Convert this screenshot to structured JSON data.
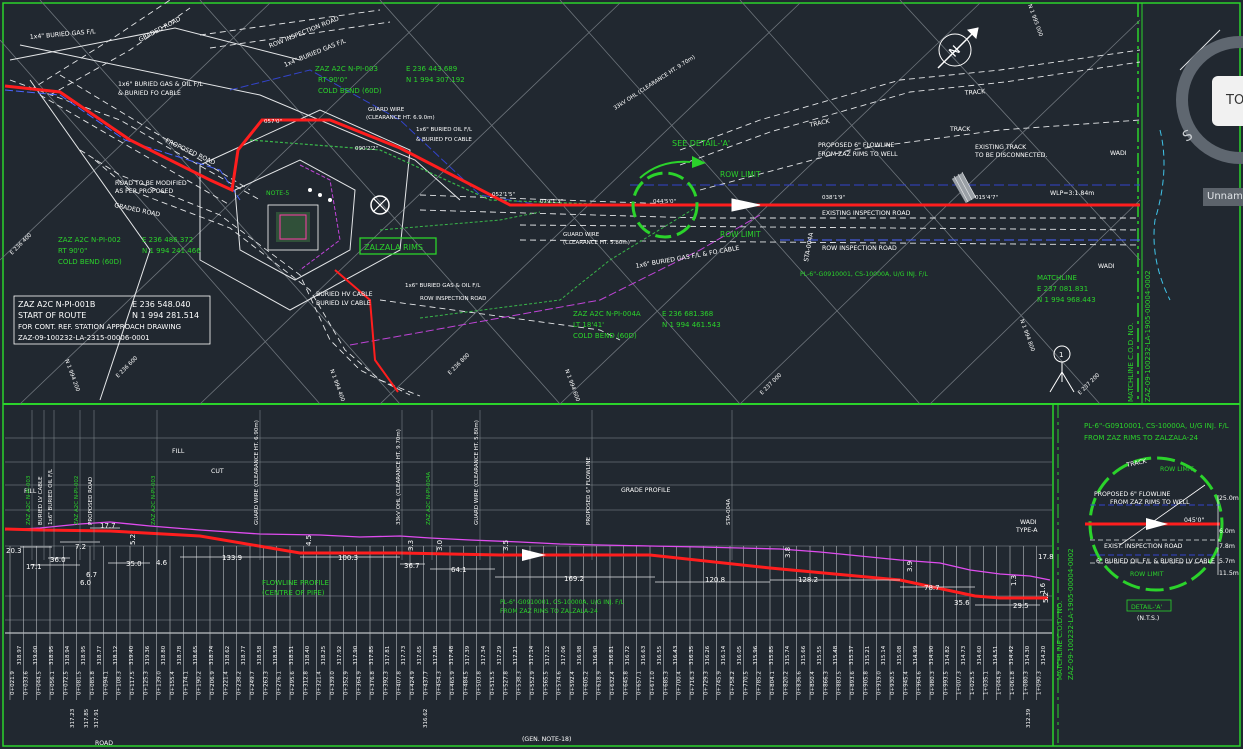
{
  "drawing": {
    "north_label": "N",
    "south_label": "S",
    "viewcube_top": "TOP",
    "unnamed_label": "Unnamed",
    "plan_labels": {
      "buried_gas_1": "1x4\" BURIED GAS F/L",
      "graded_road_1": "GRADED ROAD",
      "row_inspection_road": "ROW INSPECTION ROAD",
      "buried_gas_2": "1x4\" BURIED GAS F/L",
      "pi003_title": "ZAZ A2C N-PI-003",
      "pi003_e": "E   236 443.689",
      "pi003_rt": "RT 90'0\"",
      "pi003_n": "N 1 994 307.192",
      "pi003_bend": "COLD BEND (60D)",
      "ohl_33kv": "33kV OHL (CLEARANCE HT. 9.70m)",
      "buried_gas_oil": "1x6\" BURIED GAS & OIL F/L",
      "buried_fo": "& BURIED FO CABLE",
      "guard_wire_1": "GUARD WIRE",
      "guard_wire_1b": "(CLEARANCE HT. 6.9.0m)",
      "buried_oil_fl": "1x6\" BURIED OIL F/L",
      "buried_fo2": "& BURIED FO CABLE",
      "angle_057": "057'0\"",
      "angle_090": "090'2'2\"",
      "angle_052": "052'1'5\"",
      "angle_079": "079'1'3\"",
      "angle_044": "044'5'0\"",
      "angle_038": "038'1'9\"",
      "angle_015": "015'4'7\"",
      "proposed_road": "PROPOSED ROAD",
      "road_modified_1": "ROAD TO BE MODIFIED",
      "road_modified_2": "AS PER PROPOSED",
      "graded_road_2": "GRADED ROAD",
      "note5": "NOTE-5",
      "see_detail": "SEE DETAIL-'A'",
      "row_limit_1": "ROW LIMIT",
      "row_limit_2": "ROW LIMIT",
      "proposed_flowline_1": "PROPOSED 6\" FLOWLINE",
      "proposed_flowline_2": "FROM ZAZ RIMS TO WELL",
      "track_1": "TRACK",
      "track_2": "TRACK",
      "track_3": "TRACK",
      "existing_track_1": "EXISTING TRACK",
      "existing_track_2": "TO BE DISCONNECTED.",
      "wadi_1": "WADI",
      "wadi_2": "WADI",
      "wlp": "WLP=3:1.84m",
      "existing_inspection_road": "EXISTING INSPECTION ROAD",
      "row_inspection_road_2": "ROW INSPECTION ROAD",
      "sta004a": "STA-004A",
      "pl_green": "PL-6\"-G0910001, CS-10000A, U/G INJ. F/L",
      "guard_wire_2": "GUARD WIRE",
      "guard_wire_2b": "(CLEARANCE HT. 5.80m)",
      "buried_gas_fo": "1x6\" BURIED GAS F/L & FO CABLE",
      "matchline": "MATCHLINE",
      "matchline_e": "E   237 081.831",
      "matchline_n": "N 1 994 968.443",
      "zalzala_rims": "ZALZALA RIMS",
      "pi002_title": "ZAZ A2C N-PI-002",
      "pi002_e": "E   236 486.372",
      "pi002_rt": "RT 90'0\"",
      "pi002_n": "N 1 994 241.466",
      "pi002_bend": "COLD BEND (60D)",
      "buried_hv": "BURIED HV CABLE",
      "buried_lv": "BURIED LV CABLE",
      "buried_gas_oil_2": "1x6\" BURIED GAS & OIL F/L",
      "row_inspection_road_3": "ROW INSPECTION ROAD",
      "pi004a_title": "ZAZ A2C N-PI-004A",
      "pi004a_e": "E   236 681.368",
      "pi004a_lt": "LT 18'41'",
      "pi004a_n": "N 1 994 461.543",
      "pi004a_bend": "COLD BEND (60D)",
      "pi001b_title": "ZAZ A2C N-PI-001B",
      "pi001b_e": "E   236 548.040",
      "pi001b_start": "START OF ROUTE",
      "pi001b_n": "N 1 994 281.514",
      "pi001b_cont": "FOR CONT. REF. STATION APPROACH DRAWING",
      "pi001b_dwg": "ZAZ-09-100232-LA-2315-00006-0001",
      "grid_e236400": "E 236 400",
      "grid_e236600": "E 236 600",
      "grid_e236800": "E 236 800",
      "grid_n1994200": "N 1 994 200",
      "grid_n1994400": "N 1 994 400",
      "grid_e237000": "E 237 000",
      "grid_e237200": "E 237 200",
      "grid_n1994800": "N 1 994 800",
      "grid_n1995000": "N 1 995 000",
      "grid_n1994600": "N 1 994 600",
      "matchline_dwg_1": "MATCHLINE C.O.D. NO.",
      "matchline_dwg_2": "ZAZ-09-100232-LA-1905-00004-0002",
      "circle_1": "1"
    },
    "profile_labels": {
      "fill_1": "FILL",
      "cut": "CUT",
      "fill_2": "FILL",
      "grade_profile": "GRADE PROFILE",
      "flowline_profile_1": "FLOWLINE PROFILE",
      "flowline_profile_2": "(CENTRE OF PIPE)",
      "pl_green_1": "PL-6\"-G0910001, CS-10000A, U/G INJ. F/L",
      "pl_green_2": "FROM ZAZ RIMS TO ZALZALA-24",
      "gen_note": "(GEN. NOTE-18)",
      "road_bottom": "ROAD",
      "wadi_type": "WADI",
      "wadi_type_2": "TYPE-A",
      "vertical_labels": [
        "ZAZ A2C N-PI-003",
        "BURIED LV CABLE",
        "1x6\" BURIED OIL F/L",
        "ZAZ A2C N-PI-002",
        "PROPOSED ROAD",
        "ZAZ A2C N-PI-003",
        "GUARD WIRE (CLEARANCE HT. 6.90m)",
        "33kV OHL (CLEARANCE HT. 9.70m)",
        "ZAZ A2C N-PI-004A",
        "GUARD WIRE (CLEARANCE HT. 5.80m)",
        "PROPOSED 6\" FLOWLINE",
        "STA-004A"
      ],
      "dimensions_top": [
        "20.3",
        "17.1",
        "36.0",
        "7.2",
        "17.7",
        "5.2",
        "4.6",
        "35.0",
        "6.0",
        "6.7",
        "133.9",
        "100.3",
        "4.5",
        "36.7",
        "3.3",
        "3.0",
        "64.1",
        "3.5",
        "169.2",
        "120.8",
        "3.8",
        "128.2",
        "3.9",
        "78.7",
        "35.6",
        "29.5",
        "1.3",
        "17.8",
        "1.6",
        "5.2"
      ],
      "detail_title_1": "PL-6\"-G0910001, CS-10000A, U/G INJ. F/L",
      "detail_title_2": "FROM ZAZ RIMS TO ZALZALA-24",
      "detail_track": "TRACK",
      "detail_row_limit_1": "ROW LIMIT",
      "detail_row_limit_2": "ROW LIMIT",
      "detail_flowline_1": "PROPOSED 6\" FLOWLINE",
      "detail_flowline_2": "FROM ZAZ RIMS TO WELL",
      "detail_exist_road": "EXIST. INSPECTION ROAD",
      "detail_buried": "6\" BURIED OIL F/L & BURIED LV CABLE",
      "detail_angle": "045'0\"",
      "detail_dims": [
        "25.0m",
        "6.0m",
        "7.8m",
        "5.7m",
        "11.5m"
      ],
      "detail_caption": "DETAIL-'A'",
      "detail_nts": "(N.T.S.)",
      "matchline_vert_1": "MATCHLINE C.O.D. NO.",
      "matchline_vert_2": "ZAZ-09-100232-LA-1905-00004-0002"
    },
    "stationing_rows": [
      "0+021.9",
      "0+033.6",
      "0+044.5",
      "0+056.1",
      "0+072.5",
      "0+081.5",
      "0+085.8",
      "0+094.1",
      "0+108.3",
      "0+117.5",
      "0+125.3",
      "0+139.0",
      "0+155.4",
      "0+174.1",
      "0+190.2",
      "0+206.9",
      "0+221.4",
      "0+238.2",
      "0+249.7",
      "0+263.3",
      "0+276.1",
      "0+295.6",
      "0+312.8",
      "0+321.4",
      "0+339.0",
      "0+352.9",
      "0+364.9",
      "0+376.8",
      "0+392.3",
      "0+407.8",
      "0+424.9",
      "0+437.7",
      "0+454.3",
      "0+465.9",
      "0+484.5",
      "0+503.8",
      "0+515.5",
      "0+527.8",
      "0+538.3",
      "0+552.9",
      "0+565.5",
      "0+574.6",
      "0+592.4",
      "0+605.2",
      "0+618.9",
      "0+632.4",
      "0+645.8",
      "0+657.1",
      "0+671.0",
      "0+685.3",
      "0+700.4",
      "0+716.3",
      "0+729.3",
      "0+745.9",
      "0+758.2",
      "0+770.5",
      "0+785.2",
      "0+804.1",
      "0+820.2",
      "0+836.6",
      "0+850.4",
      "0+866.3",
      "0+883.5",
      "0+893.6",
      "0+905.8",
      "0+919.0",
      "0+930.5",
      "0+945.4",
      "0+964.6",
      "0+980.3",
      "0+993.5",
      "1+007.3",
      "1+025.5",
      "1+035.1",
      "1+044.9",
      "1+061.8",
      "1+080.3",
      "1+090.3"
    ],
    "stationing_lower": [
      "318.97",
      "319.00",
      "318.95",
      "318.94",
      "318.95",
      "318.77",
      "318.12",
      "319.40",
      "319.36",
      "318.80",
      "318.78",
      "318.65",
      "318.74",
      "318.62",
      "318.77",
      "318.58",
      "318.59",
      "318.51",
      "318.40",
      "318.25",
      "317.92",
      "317.90",
      "317.85",
      "317.81",
      "317.73",
      "317.65",
      "317.58",
      "317.48",
      "317.39",
      "317.34",
      "317.29",
      "317.21",
      "317.14",
      "317.12",
      "317.06",
      "316.98",
      "316.90",
      "316.81",
      "316.72",
      "316.63",
      "316.55",
      "316.43",
      "316.35",
      "316.26",
      "316.14",
      "316.05",
      "315.96",
      "315.85",
      "315.74",
      "315.66",
      "315.55",
      "315.48",
      "315.37",
      "315.21",
      "315.14",
      "315.08",
      "314.99",
      "314.90",
      "314.82",
      "314.73",
      "314.60",
      "314.51",
      "314.42",
      "314.30",
      "314.20"
    ],
    "bottom_vertical_values": [
      "317.23",
      "317.85",
      "317.91",
      "316.62",
      "312.39"
    ]
  }
}
